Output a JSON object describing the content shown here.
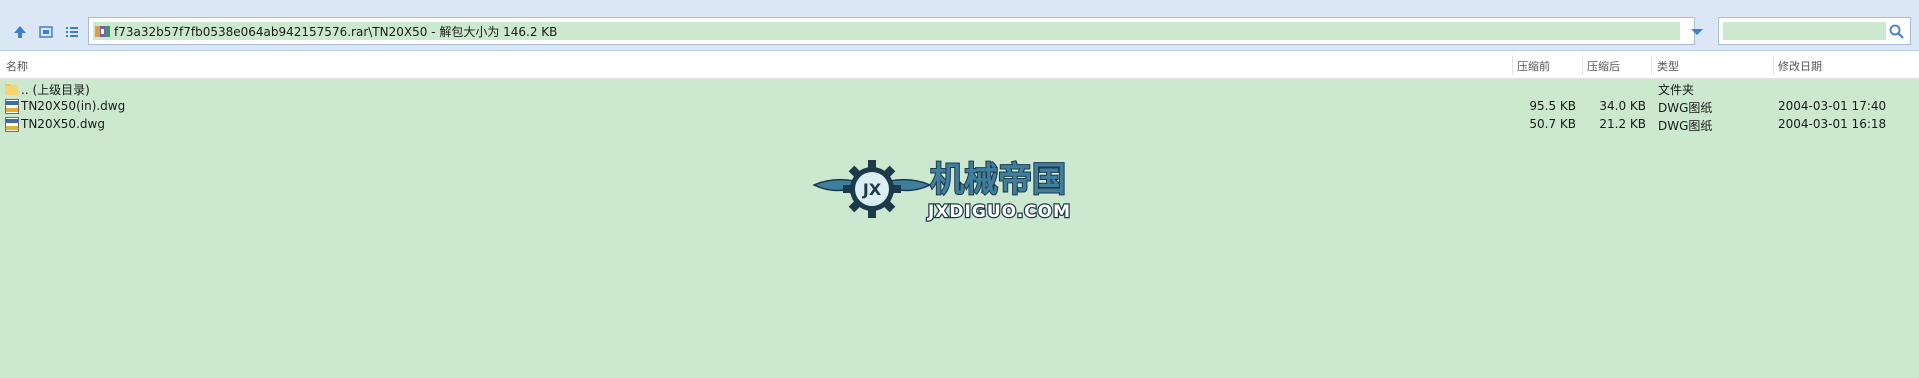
{
  "address": {
    "path": "f73a32b57f7fb0538e064ab942157576.rar\\TN20X50 - 解包大小为 146.2 KB"
  },
  "columns": {
    "name": "名称",
    "packed": "压缩前",
    "unpacked": "压缩后",
    "type": "类型",
    "modified": "修改日期"
  },
  "files": [
    {
      "name": ".. (上级目录)",
      "packed": "",
      "unpacked": "",
      "type": "文件夹",
      "modified": "",
      "icon": "folder-icon"
    },
    {
      "name": "TN20X50(in).dwg",
      "packed": "95.5 KB",
      "unpacked": "34.0 KB",
      "type": "DWG图纸",
      "modified": "2004-03-01 17:40",
      "icon": "dwg-file-icon"
    },
    {
      "name": "TN20X50.dwg",
      "packed": "50.7 KB",
      "unpacked": "21.2 KB",
      "type": "DWG图纸",
      "modified": "2004-03-01 16:18",
      "icon": "dwg-file-icon"
    }
  ],
  "watermark": {
    "title": "机械帝国",
    "subtitle": "JXDIGUO.COM"
  },
  "colors": {
    "background": "#cce8cf",
    "toolbar": "#dbe7f5",
    "accent": "#3a7fd5"
  }
}
